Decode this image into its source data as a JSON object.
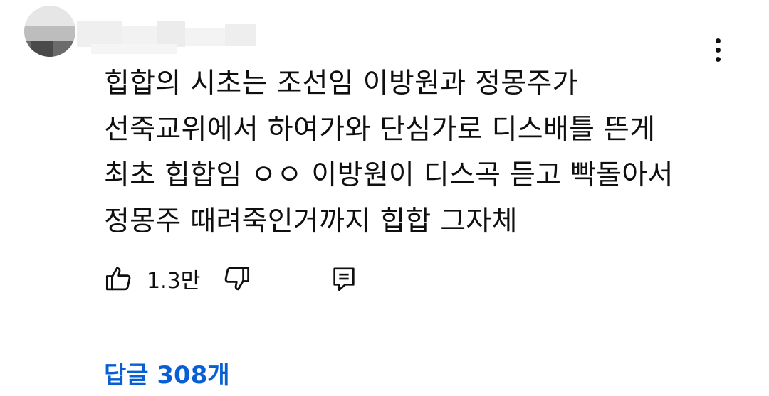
{
  "comment": {
    "lines": [
      "힙합의 시초는 조선임 이방원과 정몽주가",
      "선죽교위에서 하여가와 단심가로 디스배틀 뜬게",
      "최초 힙합임 ㅇㅇ 이방원이 디스곡 듣고 빡돌아서",
      "정몽주 때려죽인거까지 힙합 그자체"
    ]
  },
  "actions": {
    "like_count": "1.3만",
    "like_icon": "thumbs-up-icon",
    "dislike_icon": "thumbs-down-icon",
    "reply_icon": "comment-reply-icon"
  },
  "replies": {
    "label": "답글 308개"
  },
  "menu": {
    "icon": "more-vertical-icon"
  },
  "colors": {
    "text": "#0f0f0f",
    "link": "#065fd4",
    "background": "#ffffff"
  }
}
